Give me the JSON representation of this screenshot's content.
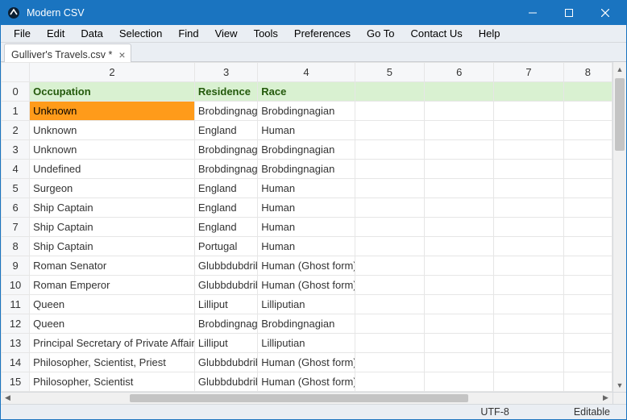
{
  "app": {
    "title": "Modern CSV"
  },
  "window_controls": {
    "min": "minimize",
    "max": "maximize",
    "close": "close"
  },
  "menu": [
    "File",
    "Edit",
    "Data",
    "Selection",
    "Find",
    "View",
    "Tools",
    "Preferences",
    "Go To",
    "Contact Us",
    "Help"
  ],
  "tab": {
    "label": "Gulliver's Travels.csv *",
    "close": "×"
  },
  "columns": [
    "2",
    "3",
    "4",
    "5",
    "6",
    "7",
    "8"
  ],
  "rows": [
    {
      "idx": "0",
      "cells": [
        "Occupation",
        "Residence",
        "Race",
        "",
        "",
        "",
        ""
      ],
      "header": true
    },
    {
      "idx": "1",
      "cells": [
        "Unknown",
        "Brobdingnag",
        "Brobdingnagian",
        "",
        "",
        "",
        ""
      ],
      "selected": true
    },
    {
      "idx": "2",
      "cells": [
        "Unknown",
        "England",
        "Human",
        "",
        "",
        "",
        ""
      ]
    },
    {
      "idx": "3",
      "cells": [
        "Unknown",
        "Brobdingnag",
        "Brobdingnagian",
        "",
        "",
        "",
        ""
      ]
    },
    {
      "idx": "4",
      "cells": [
        "Undefined",
        "Brobdingnag",
        "Brobdingnagian",
        "",
        "",
        "",
        ""
      ]
    },
    {
      "idx": "5",
      "cells": [
        "Surgeon",
        "England",
        "Human",
        "",
        "",
        "",
        ""
      ]
    },
    {
      "idx": "6",
      "cells": [
        "Ship Captain",
        "England",
        "Human",
        "",
        "",
        "",
        ""
      ]
    },
    {
      "idx": "7",
      "cells": [
        "Ship Captain",
        "England",
        "Human",
        "",
        "",
        "",
        ""
      ]
    },
    {
      "idx": "8",
      "cells": [
        "Ship Captain",
        "Portugal",
        "Human",
        "",
        "",
        "",
        ""
      ]
    },
    {
      "idx": "9",
      "cells": [
        "Roman Senator",
        "Glubbdubdrib",
        "Human (Ghost form)",
        "",
        "",
        "",
        ""
      ]
    },
    {
      "idx": "10",
      "cells": [
        "Roman Emperor",
        "Glubbdubdrib",
        "Human (Ghost form)",
        "",
        "",
        "",
        ""
      ]
    },
    {
      "idx": "11",
      "cells": [
        "Queen",
        "Lilliput",
        "Lilliputian",
        "",
        "",
        "",
        ""
      ]
    },
    {
      "idx": "12",
      "cells": [
        "Queen",
        "Brobdingnag",
        "Brobdingnagian",
        "",
        "",
        "",
        ""
      ]
    },
    {
      "idx": "13",
      "cells": [
        "Principal Secretary of Private Affairs",
        "Lilliput",
        "Lilliputian",
        "",
        "",
        "",
        ""
      ]
    },
    {
      "idx": "14",
      "cells": [
        "Philosopher, Scientist, Priest",
        "Glubbdubdrib",
        "Human (Ghost form)",
        "",
        "",
        "",
        ""
      ]
    },
    {
      "idx": "15",
      "cells": [
        "Philosopher, Scientist",
        "Glubbdubdrib",
        "Human (Ghost form)",
        "",
        "",
        "",
        ""
      ]
    }
  ],
  "status": {
    "encoding": "UTF-8",
    "mode": "Editable"
  }
}
